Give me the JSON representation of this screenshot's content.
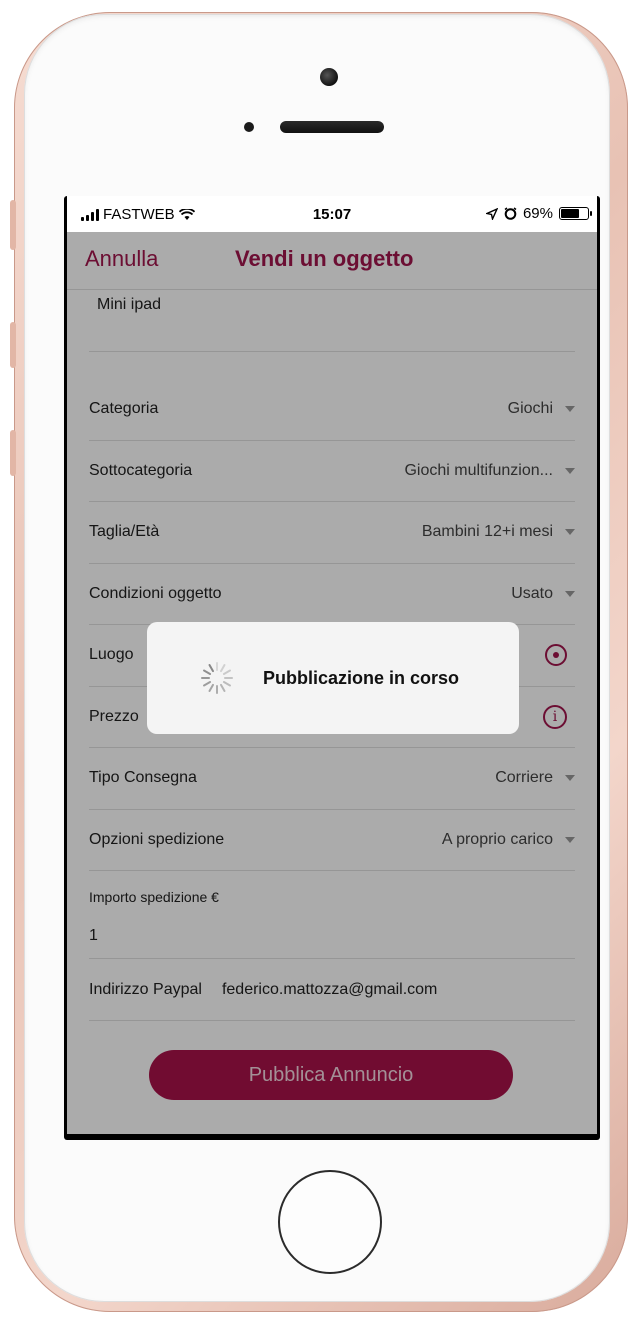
{
  "status_bar": {
    "carrier": "FASTWEB",
    "time": "15:07",
    "battery": "69%",
    "battery_level": 0.69
  },
  "nav": {
    "cancel_label": "Annulla",
    "title": "Vendi un oggetto"
  },
  "form": {
    "description_value": "Mini ipad",
    "rows": {
      "category": {
        "label": "Categoria",
        "value": "Giochi"
      },
      "subcategory": {
        "label": "Sottocategoria",
        "value": "Giochi multifunzion..."
      },
      "size_age": {
        "label": "Taglia/Età",
        "value": "Bambini 12+i mesi"
      },
      "condition": {
        "label": "Condizioni oggetto",
        "value": "Usato"
      },
      "place": {
        "label": "Luogo"
      },
      "price": {
        "label": "Prezzo"
      },
      "delivery_type": {
        "label": "Tipo Consegna",
        "value": "Corriere"
      },
      "shipping_options": {
        "label": "Opzioni spedizione",
        "value": "A proprio carico"
      }
    },
    "shipping_amount": {
      "label": "Importo spedizione €",
      "value": "1"
    },
    "paypal": {
      "label": "Indirizzo Paypal",
      "value": "federico.mattozza@gmail.com"
    },
    "publish_label": "Pubblica Annuncio"
  },
  "hud": {
    "message": "Pubblicazione in corso"
  },
  "colors": {
    "accent": "#a2164d",
    "button": "#a9124a"
  },
  "icons": {
    "location": "crosshair-target-icon",
    "price_info": "info-icon",
    "dropdown": "chevron-down-icon"
  }
}
